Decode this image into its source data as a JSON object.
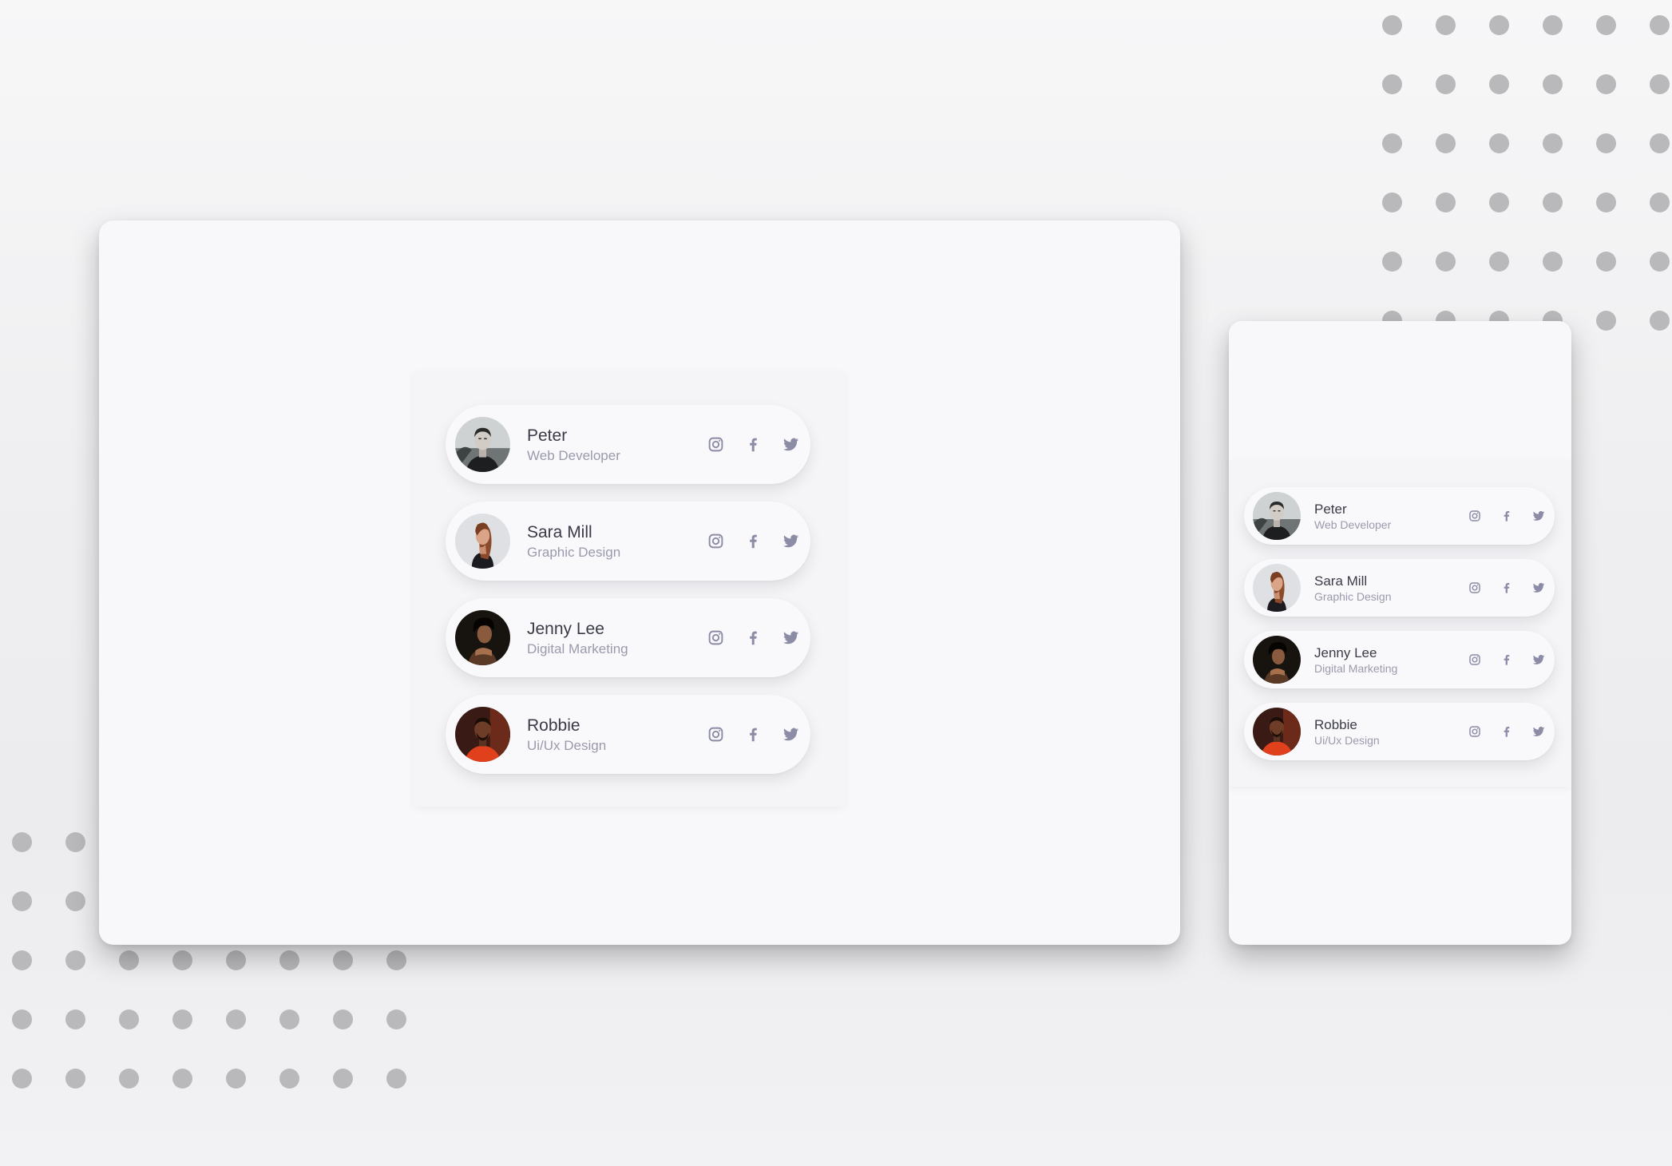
{
  "colors": {
    "page_background": "#efeff1",
    "frame_background": "#f8f8fb",
    "dot": "#b9b9bb",
    "name_text": "#3b3b48",
    "role_text": "#9a9aac",
    "icon": "#8c8ca6"
  },
  "desktop": {
    "members": [
      {
        "name": "Peter",
        "role": "Web Developer",
        "avatar": "man-avatar-bw"
      },
      {
        "name": "Sara Mill",
        "role": "Graphic Design",
        "avatar": "woman-avatar-light"
      },
      {
        "name": "Jenny Lee",
        "role": "Digital Marketing",
        "avatar": "woman-avatar-dark"
      },
      {
        "name": "Robbie",
        "role": "Ui/Ux Design",
        "avatar": "man-avatar-orange"
      }
    ]
  },
  "mobile": {
    "members": [
      {
        "name": "Peter",
        "role": "Web Developer",
        "avatar": "man-avatar-bw"
      },
      {
        "name": "Sara Mill",
        "role": "Graphic Design",
        "avatar": "woman-avatar-light"
      },
      {
        "name": "Jenny Lee",
        "role": "Digital Marketing",
        "avatar": "woman-avatar-dark"
      },
      {
        "name": "Robbie",
        "role": "Ui/Ux Design",
        "avatar": "man-avatar-orange"
      }
    ]
  },
  "social_icons": [
    "instagram-icon",
    "facebook-icon",
    "twitter-icon"
  ]
}
